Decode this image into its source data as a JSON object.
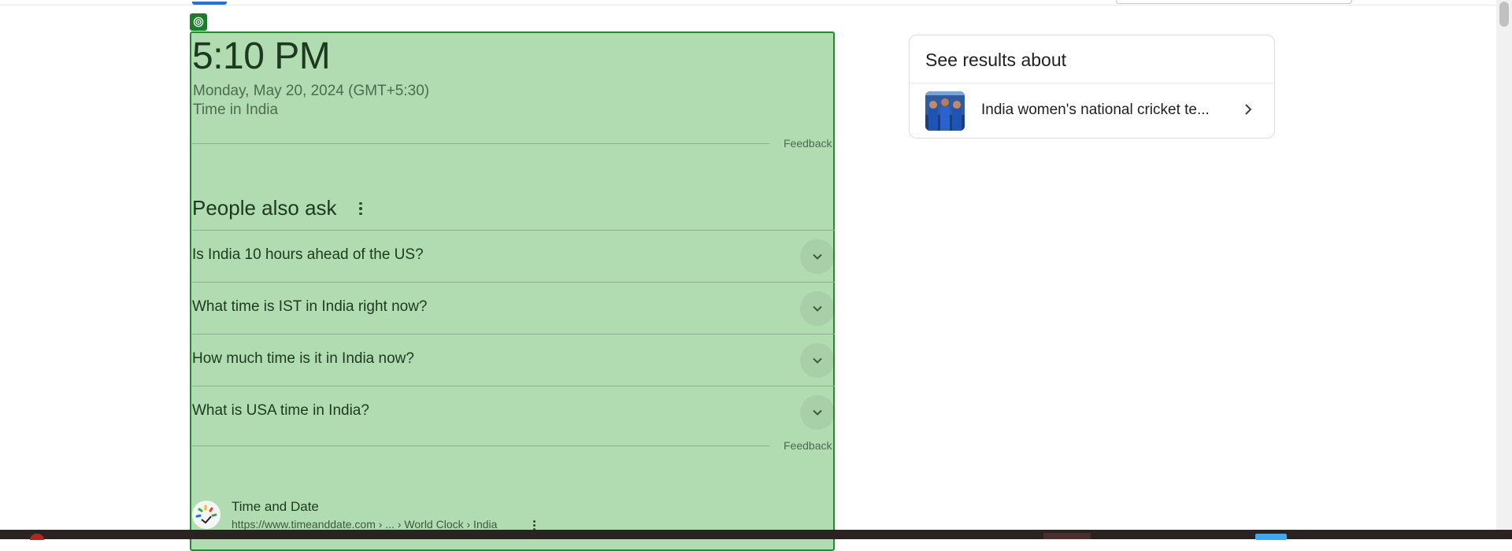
{
  "time_card": {
    "time": "5:10 PM",
    "date": "Monday, May 20, 2024 (GMT+5:30)",
    "location": "Time in India",
    "feedback": "Feedback"
  },
  "people_also_ask": {
    "title": "People also ask",
    "more_icon": "more-vert-icon",
    "questions": [
      "Is India 10 hours ahead of the US?",
      "What time is IST in India right now?",
      "How much time is it in India now?",
      "What is USA time in India?"
    ],
    "expand_icon": "chevron-down-icon",
    "feedback": "Feedback"
  },
  "result": {
    "source": "Time and Date",
    "url": "https://www.timeanddate.com › ... › World Clock › India",
    "logo_icon": "timeanddate-logo-icon"
  },
  "knowledge_panel": {
    "title": "See results about",
    "item_label": "India women's national cricket te...",
    "thumbnail": "team-photo-thumbnail",
    "chevron_icon": "chevron-right-icon"
  },
  "overlay": {
    "badge_icon": "target-icon"
  },
  "colors": {
    "overlay_fill": "#69ba68",
    "overlay_border": "#1e8f2a",
    "accent_tab": "#1a73e8"
  }
}
